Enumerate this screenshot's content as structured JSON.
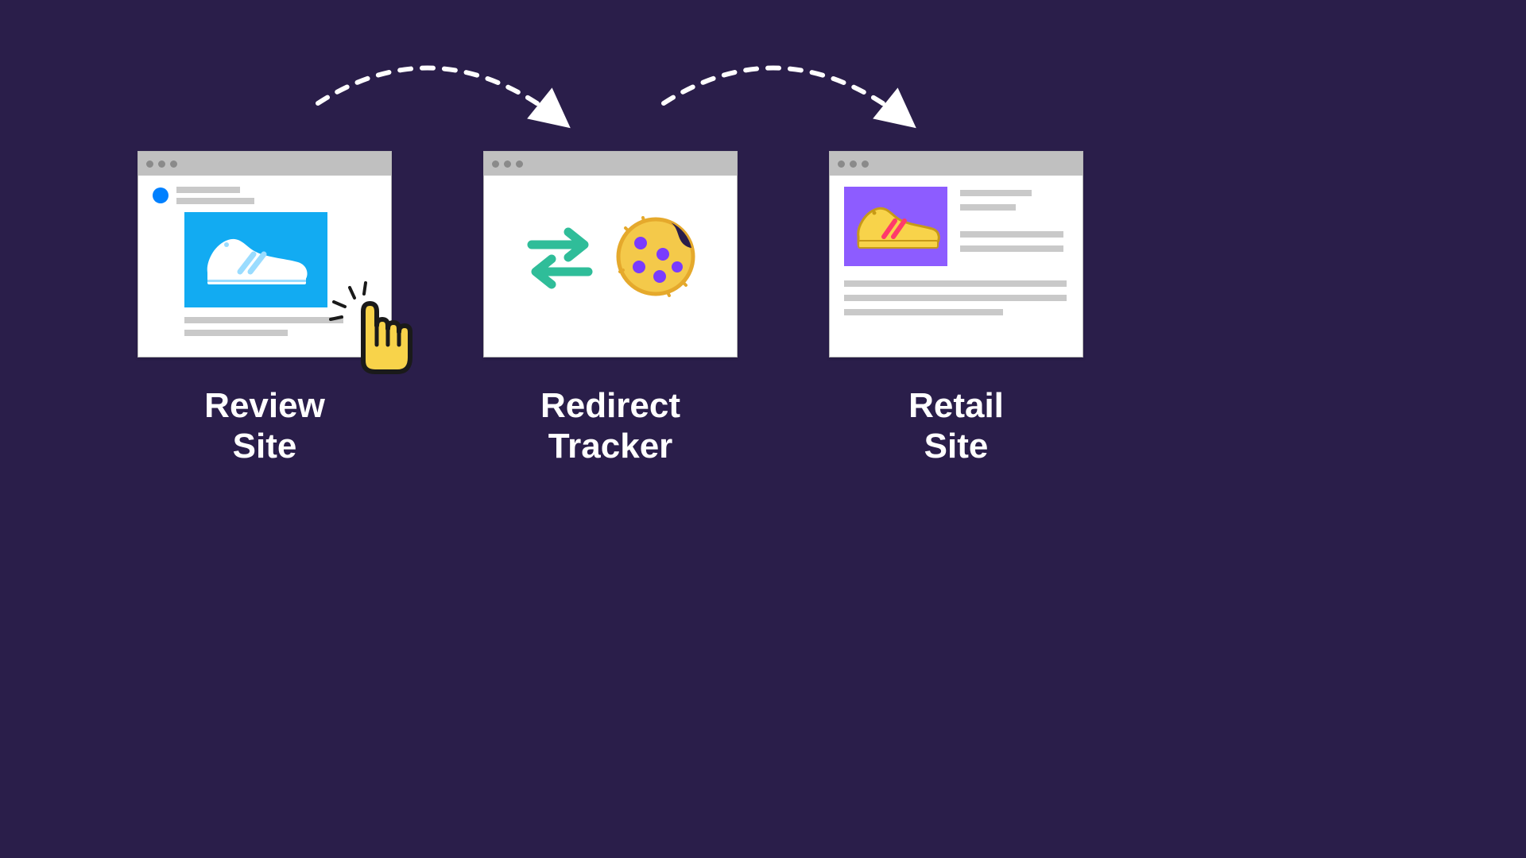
{
  "colors": {
    "background": "#2a1e4a",
    "titlebar": "#c0c0c0",
    "placeholder_line": "#c9c9c9",
    "avatar_blue": "#0080ff",
    "shoe_panel_blue": "#12abf2",
    "shoe_white": "#ffffff",
    "shoe_white_stripe": "#9adcff",
    "thumb_purple": "#8d5cff",
    "shoe_yellow": "#f8d34a",
    "shoe_yellow_stripe": "#ff3a6b",
    "cookie_body": "#f4c94a",
    "cookie_edge": "#e5a92c",
    "cookie_chip": "#7a3bff",
    "swap_arrows": "#2fbd99",
    "cursor_fill": "#f8d34a",
    "cursor_stroke": "#1a1a1a",
    "arrow_stroke": "#ffffff"
  },
  "icons": {
    "window1_shoe": "shoe-white",
    "window1_cursor": "pointer-cursor-click",
    "window2_swap": "swap-arrows",
    "window2_cookie": "cookie",
    "window3_shoe": "shoe-yellow"
  },
  "nodes": [
    {
      "id": "review",
      "label": "Review\nSite"
    },
    {
      "id": "tracker",
      "label": "Redirect\nTracker"
    },
    {
      "id": "retail",
      "label": "Retail\nSite"
    }
  ],
  "flow": [
    {
      "from": "review",
      "to": "tracker"
    },
    {
      "from": "tracker",
      "to": "retail"
    }
  ]
}
